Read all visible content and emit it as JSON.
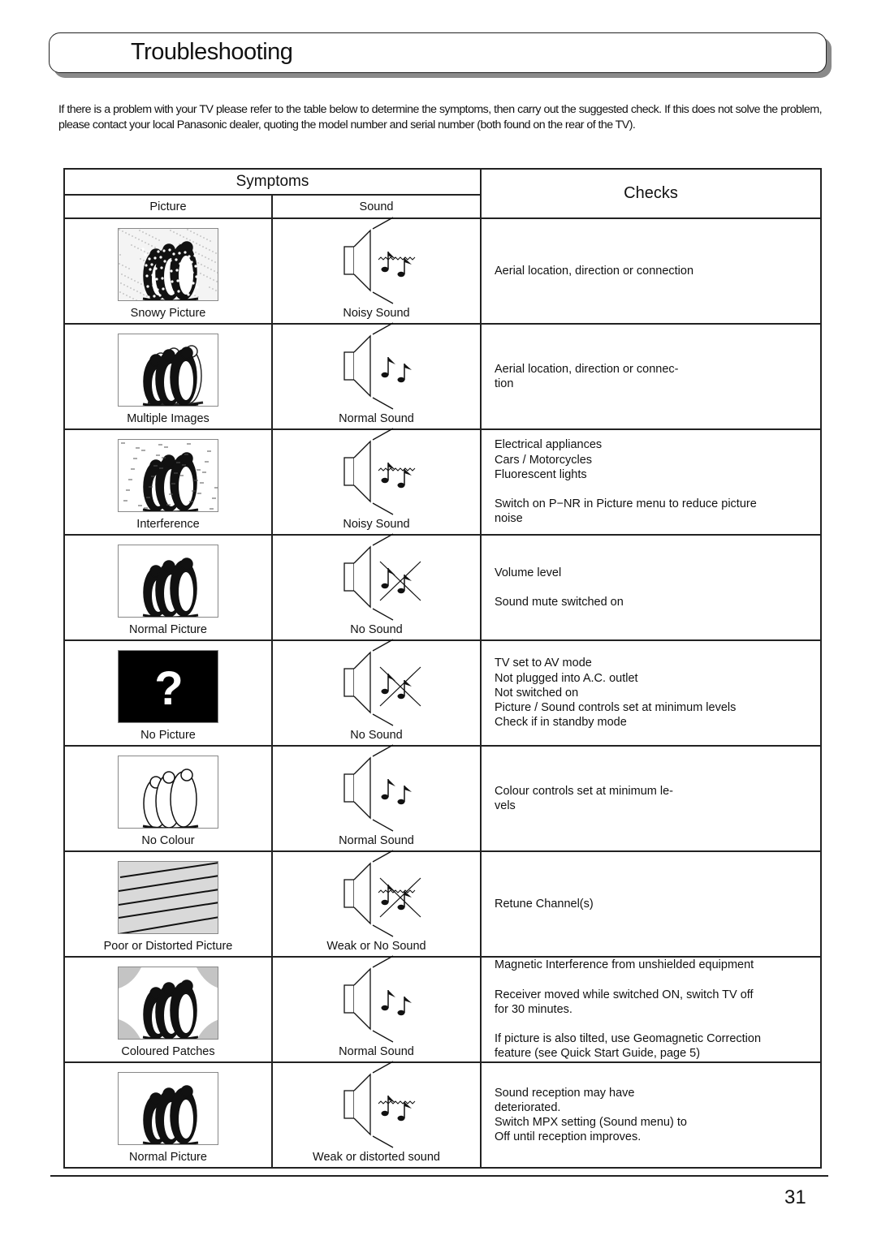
{
  "page": {
    "title": "Troubleshooting",
    "intro": "If there is a problem with your TV please refer to the table below to determine the symptoms, then carry out the suggested check. If this does not solve the problem, please contact your local Panasonic dealer, quoting the model number and serial number (both found on the rear of the TV).",
    "page_number": "31"
  },
  "table": {
    "header_symptoms": "Symptoms",
    "header_checks": "Checks",
    "header_picture": "Picture",
    "header_sound": "Sound",
    "rows": [
      {
        "picture": "Snowy Picture",
        "picture_icon": "snowy-penguins-icon",
        "sound": "Noisy Sound",
        "sound_icon": "noisy-speaker-icon",
        "checks": [
          [
            "Aerial location, direction or connection"
          ]
        ]
      },
      {
        "picture": "Multiple Images",
        "picture_icon": "ghost-penguins-icon",
        "sound": "Normal Sound",
        "sound_icon": "normal-speaker-icon",
        "checks": [
          [
            "Aerial location, direction or connec-",
            "tion"
          ]
        ]
      },
      {
        "picture": "Interference",
        "picture_icon": "interference-penguins-icon",
        "sound": "Noisy Sound",
        "sound_icon": "noisy-speaker-icon",
        "checks": [
          [
            "Electrical appliances",
            "Cars / Motorcycles",
            "Fluorescent lights"
          ],
          [
            "Switch on P−NR in Picture menu to reduce picture",
            "noise"
          ]
        ]
      },
      {
        "picture": "Normal Picture",
        "picture_icon": "penguins-icon",
        "sound": "No Sound",
        "sound_icon": "muted-speaker-icon",
        "checks": [
          [
            "Volume level"
          ],
          [
            "Sound mute switched on"
          ]
        ]
      },
      {
        "picture": "No Picture",
        "picture_icon": "question-mark-icon",
        "sound": "No Sound",
        "sound_icon": "muted-speaker-icon",
        "checks": [
          [
            "TV set to AV mode",
            "Not plugged into A.C. outlet",
            "Not switched on",
            "Picture / Sound controls set at minimum levels",
            "Check if in standby mode"
          ]
        ]
      },
      {
        "picture": "No Colour",
        "picture_icon": "outline-penguins-icon",
        "sound": "Normal Sound",
        "sound_icon": "normal-speaker-icon",
        "checks": [
          [
            "Colour controls set at minimum le-",
            "vels"
          ]
        ]
      },
      {
        "picture": "Poor or Distorted Picture",
        "picture_icon": "distorted-lines-icon",
        "sound": "Weak or No Sound",
        "sound_icon": "weak-muted-speaker-icon",
        "checks": [
          [
            "Retune Channel(s)"
          ]
        ]
      },
      {
        "picture": "Coloured Patches",
        "picture_icon": "patched-penguins-icon",
        "sound": "Normal Sound",
        "sound_icon": "normal-speaker-icon",
        "checks": [
          [
            "Magnetic Interference from unshielded equipment"
          ],
          [
            "Receiver moved while switched ON, switch TV off",
            "for 30 minutes."
          ],
          [
            "If picture is also tilted, use Geomagnetic Correction",
            "feature (see Quick Start Guide, page 5)"
          ]
        ]
      },
      {
        "picture": "Normal Picture",
        "picture_icon": "penguins-icon",
        "sound": "Weak or distorted sound",
        "sound_icon": "noisy-speaker-icon",
        "checks": [
          [
            "Sound reception may have",
            "deteriorated.",
            "Switch MPX setting (Sound menu) to",
            "Off until reception improves."
          ]
        ]
      }
    ]
  }
}
